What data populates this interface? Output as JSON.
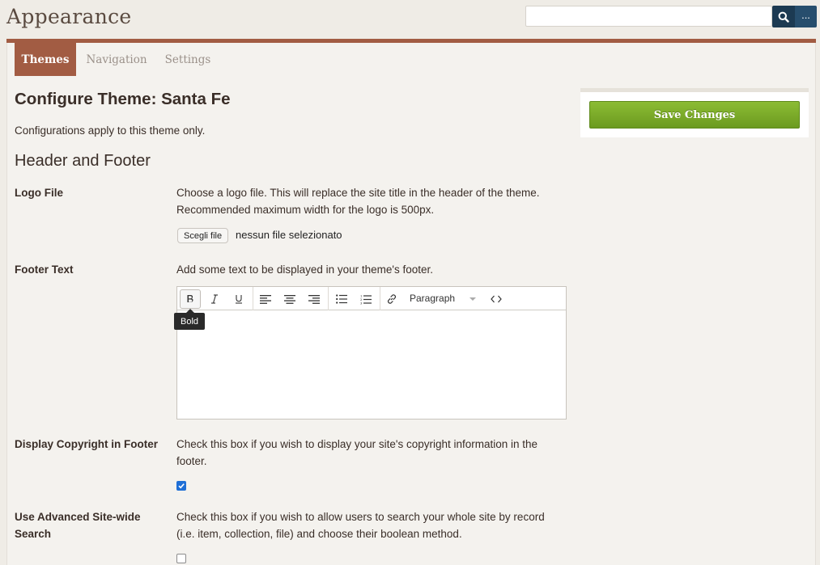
{
  "header": {
    "title": "Appearance",
    "search": {
      "value": "",
      "placeholder": "",
      "more_label": "..."
    }
  },
  "tabs": [
    {
      "label": "Themes",
      "active": true
    },
    {
      "label": "Navigation",
      "active": false
    },
    {
      "label": "Settings",
      "active": false
    }
  ],
  "main": {
    "title": "Configure Theme: Santa Fe",
    "subtitle": "Configurations apply to this theme only.",
    "section_title": "Header and Footer"
  },
  "fields": {
    "logo": {
      "label": "Logo File",
      "description": "Choose a logo file. This will replace the site title in the header of the theme. Recommended maximum width for the logo is 500px.",
      "button_label": "Scegli file",
      "status": "nessun file selezionato"
    },
    "footer_text": {
      "label": "Footer Text",
      "description": "Add some text to be displayed in your theme's footer."
    },
    "copyright": {
      "label": "Display Copyright in Footer",
      "description": "Check this box if you wish to display your site's copyright information in the footer.",
      "checked": true
    },
    "advanced_search": {
      "label": "Use Advanced Site-wide Search",
      "description": "Check this box if you wish to allow users to search your whole site by record (i.e. item, collection, file) and choose their boolean method.",
      "checked": false
    }
  },
  "editor": {
    "format_label": "Paragraph",
    "tooltip": "Bold",
    "content": ""
  },
  "sidebar": {
    "save_label": "Save Changes"
  },
  "colors": {
    "accent": "#a25c43",
    "save_button": "#7aab29",
    "search_button": "#1c3a52"
  }
}
